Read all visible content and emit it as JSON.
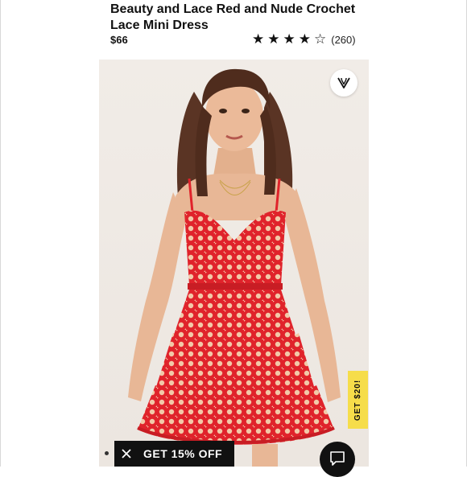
{
  "product": {
    "title": "Beauty and Lace Red and Nude Crochet Lace Mini Dress",
    "price": "$66",
    "rating": 4,
    "rating_max": 5,
    "review_count": "(260)"
  },
  "image": {
    "wishlist_icon": "v-heart-logo-icon"
  },
  "promos": {
    "side_tab": "GET $20!",
    "bottom_bar": "GET 15% OFF"
  },
  "colors": {
    "dress": "#e0232b",
    "side_tab_bg": "#f6dd4a",
    "promo_bg": "#111111"
  }
}
